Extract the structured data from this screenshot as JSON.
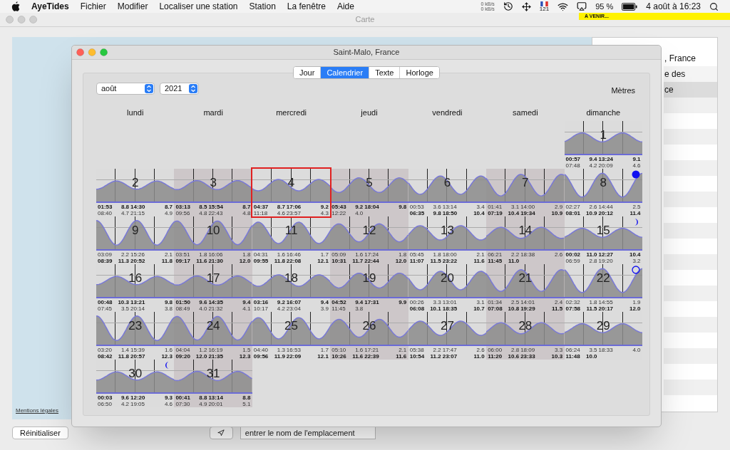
{
  "menu_bar": {
    "app": "AyeTides",
    "items": [
      "Fichier",
      "Modifier",
      "Localiser une station",
      "Station",
      "La fenêtre",
      "Aide"
    ],
    "status": {
      "net_up": "0 kB/s",
      "net_down": "0 kB/s",
      "flag_badge": "121",
      "battery": "95 %",
      "clock": "4 août à 16:23"
    }
  },
  "back_window": {
    "title": "Carte",
    "badge": "A VENIR...",
    "map": {
      "legal_link": "Mentions légales"
    },
    "stations_list": [
      {
        "label": ", France",
        "selected": false
      },
      {
        "label": "e des",
        "selected": false
      },
      {
        "label": "ce",
        "selected": true
      }
    ],
    "reset_button": "Réinitialiser",
    "location_field": {
      "placeholder": "entrer le nom de l'emplacement"
    }
  },
  "window": {
    "title": "Saint-Malo, France",
    "tabs": [
      {
        "label": "Jour",
        "selected": false
      },
      {
        "label": "Calendrier",
        "selected": true
      },
      {
        "label": "Texte",
        "selected": false
      },
      {
        "label": "Horloge",
        "selected": false
      }
    ],
    "month": "août",
    "year": "2021",
    "unit": "Mètres",
    "weekdays": [
      "lundi",
      "mardi",
      "mercredi",
      "jeudi",
      "vendredi",
      "samedi",
      "dimanche"
    ],
    "weeks": [
      [
        {
          "kind": "empty"
        },
        {
          "kind": "empty"
        },
        {
          "kind": "empty"
        },
        {
          "kind": "empty"
        },
        {
          "kind": "empty"
        },
        {
          "kind": "empty"
        },
        {
          "kind": "day",
          "number": "1",
          "selected": false,
          "lines": [
            {
              "high": true,
              "values": [
                "00:57",
                "9.4",
                "13:24",
                "9.1"
              ]
            },
            {
              "high": false,
              "values": [
                "07:48",
                "4.2",
                "20:09",
                "4.6"
              ]
            }
          ]
        }
      ],
      [
        {
          "kind": "day",
          "number": "2",
          "selected": false,
          "lines": [
            {
              "high": true,
              "values": [
                "01:53",
                "8.8",
                "14:30",
                "8.7"
              ]
            },
            {
              "high": false,
              "values": [
                "08:40",
                "4.7",
                "21:15",
                "4.9"
              ]
            }
          ]
        },
        {
          "kind": "day",
          "number": "3",
          "selected": false,
          "lines": [
            {
              "high": true,
              "values": [
                "03:13",
                "8.5",
                "15:54",
                "8.7"
              ]
            },
            {
              "high": false,
              "values": [
                "09:56",
                "4.8",
                "22:43",
                "4.8"
              ]
            }
          ]
        },
        {
          "kind": "day",
          "number": "4",
          "selected": true,
          "lines": [
            {
              "high": true,
              "values": [
                "04:37",
                "8.7",
                "17:06",
                "9.2"
              ]
            },
            {
              "high": false,
              "values": [
                "11:18",
                "4.6",
                "23:57",
                "4.3"
              ]
            }
          ]
        },
        {
          "kind": "day",
          "number": "5",
          "selected": false,
          "lines": [
            {
              "high": true,
              "values": [
                "05:43",
                "9.2",
                "18:04",
                "9.8"
              ]
            },
            {
              "high": false,
              "values": [
                "12:22",
                "4.0"
              ]
            }
          ]
        },
        {
          "kind": "day",
          "number": "6",
          "selected": false,
          "lines": [
            {
              "high": false,
              "values": [
                "00:53",
                "3.6",
                "13:14",
                "3.4"
              ]
            },
            {
              "high": true,
              "values": [
                "06:35",
                "9.8",
                "18:50",
                "10.4"
              ]
            }
          ]
        },
        {
          "kind": "day",
          "number": "7",
          "selected": false,
          "lines": [
            {
              "high": false,
              "values": [
                "01:41",
                "3.1",
                "14:00",
                "2.9"
              ]
            },
            {
              "high": true,
              "values": [
                "07:19",
                "10.4",
                "19:34",
                "10.9"
              ]
            }
          ]
        },
        {
          "kind": "day",
          "number": "8",
          "selected": false,
          "moon": {
            "kind": "new"
          },
          "lines": [
            {
              "high": false,
              "values": [
                "02:27",
                "2.6",
                "14:44",
                "2.5"
              ]
            },
            {
              "high": true,
              "values": [
                "08:01",
                "10.9",
                "20:12",
                "11.4"
              ]
            }
          ]
        }
      ],
      [
        {
          "kind": "day",
          "number": "9",
          "selected": false,
          "lines": [
            {
              "high": false,
              "values": [
                "03:09",
                "2.2",
                "15:26",
                "2.1"
              ]
            },
            {
              "high": true,
              "values": [
                "08:39",
                "11.3",
                "20:52",
                "11.8"
              ]
            }
          ]
        },
        {
          "kind": "day",
          "number": "10",
          "selected": false,
          "lines": [
            {
              "high": false,
              "values": [
                "03:51",
                "1.8",
                "16:06",
                "1.8"
              ]
            },
            {
              "high": true,
              "values": [
                "09:17",
                "11.6",
                "21:30",
                "12.0"
              ]
            }
          ]
        },
        {
          "kind": "day",
          "number": "11",
          "selected": false,
          "lines": [
            {
              "high": false,
              "values": [
                "04:31",
                "1.6",
                "16:46",
                "1.7"
              ]
            },
            {
              "high": true,
              "values": [
                "09:55",
                "11.8",
                "22:08",
                "12.1"
              ]
            }
          ]
        },
        {
          "kind": "day",
          "number": "12",
          "selected": false,
          "lines": [
            {
              "high": false,
              "values": [
                "05:09",
                "1.6",
                "17:24",
                "1.8"
              ]
            },
            {
              "high": true,
              "values": [
                "10:31",
                "11.7",
                "22:44",
                "12.0"
              ]
            }
          ]
        },
        {
          "kind": "day",
          "number": "13",
          "selected": false,
          "lines": [
            {
              "high": false,
              "values": [
                "05:45",
                "1.8",
                "18:00",
                "2.1"
              ]
            },
            {
              "high": true,
              "values": [
                "11:07",
                "11.5",
                "23:22",
                "11.6"
              ]
            }
          ]
        },
        {
          "kind": "day",
          "number": "14",
          "selected": false,
          "lines": [
            {
              "high": false,
              "values": [
                "06:21",
                "2.2",
                "18:38",
                "2.6"
              ]
            },
            {
              "high": true,
              "values": [
                "11:45",
                "11.0"
              ]
            }
          ]
        },
        {
          "kind": "day",
          "number": "15",
          "selected": false,
          "moon": {
            "kind": "first_quarter"
          },
          "lines": [
            {
              "high": true,
              "values": [
                "00:02",
                "11.0",
                "12:27",
                "10.4"
              ]
            },
            {
              "high": false,
              "values": [
                "06:59",
                "2.8",
                "19:20",
                "3.2"
              ]
            }
          ]
        }
      ],
      [
        {
          "kind": "day",
          "number": "16",
          "selected": false,
          "lines": [
            {
              "high": true,
              "values": [
                "00:48",
                "10.3",
                "13:21",
                "9.8"
              ]
            },
            {
              "high": false,
              "values": [
                "07:45",
                "3.5",
                "20:14",
                "3.8"
              ]
            }
          ]
        },
        {
          "kind": "day",
          "number": "17",
          "selected": false,
          "lines": [
            {
              "high": true,
              "values": [
                "01:50",
                "9.6",
                "14:35",
                "9.4"
              ]
            },
            {
              "high": false,
              "values": [
                "08:49",
                "4.0",
                "21:32",
                "4.1"
              ]
            }
          ]
        },
        {
          "kind": "day",
          "number": "18",
          "selected": false,
          "lines": [
            {
              "high": true,
              "values": [
                "03:16",
                "9.2",
                "16:07",
                "9.4"
              ]
            },
            {
              "high": false,
              "values": [
                "10:17",
                "4.2",
                "23:04",
                "3.9"
              ]
            }
          ]
        },
        {
          "kind": "day",
          "number": "19",
          "selected": false,
          "lines": [
            {
              "high": true,
              "values": [
                "04:52",
                "9.4",
                "17:31",
                "9.9"
              ]
            },
            {
              "high": false,
              "values": [
                "11:45",
                "3.8"
              ]
            }
          ]
        },
        {
          "kind": "day",
          "number": "20",
          "selected": false,
          "lines": [
            {
              "high": false,
              "values": [
                "00:26",
                "3.3",
                "13:01",
                "3.1"
              ]
            },
            {
              "high": true,
              "values": [
                "06:08",
                "10.1",
                "18:35",
                "10.7"
              ]
            }
          ]
        },
        {
          "kind": "day",
          "number": "21",
          "selected": false,
          "lines": [
            {
              "high": false,
              "values": [
                "01:34",
                "2.5",
                "14:01",
                "2.4"
              ]
            },
            {
              "high": true,
              "values": [
                "07:08",
                "10.8",
                "19:29",
                "11.5"
              ]
            }
          ]
        },
        {
          "kind": "day",
          "number": "22",
          "selected": false,
          "moon": {
            "kind": "full"
          },
          "lines": [
            {
              "high": false,
              "values": [
                "02:32",
                "1.8",
                "14:55",
                "1.9"
              ]
            },
            {
              "high": true,
              "values": [
                "07:58",
                "11.5",
                "20:17",
                "12.0"
              ]
            }
          ]
        }
      ],
      [
        {
          "kind": "day",
          "number": "23",
          "selected": false,
          "lines": [
            {
              "high": false,
              "values": [
                "03:20",
                "1.4",
                "15:39",
                "1.6"
              ]
            },
            {
              "high": true,
              "values": [
                "08:42",
                "11.8",
                "20:57",
                "12.3"
              ]
            }
          ]
        },
        {
          "kind": "day",
          "number": "24",
          "selected": false,
          "lines": [
            {
              "high": false,
              "values": [
                "04:04",
                "1.2",
                "16:19",
                "1.5"
              ]
            },
            {
              "high": true,
              "values": [
                "09:20",
                "12.0",
                "21:35",
                "12.3"
              ]
            }
          ]
        },
        {
          "kind": "day",
          "number": "25",
          "selected": false,
          "lines": [
            {
              "high": false,
              "values": [
                "04:40",
                "1.3",
                "16:53",
                "1.7"
              ]
            },
            {
              "high": true,
              "values": [
                "09:56",
                "11.9",
                "22:09",
                "12.1"
              ]
            }
          ]
        },
        {
          "kind": "day",
          "number": "26",
          "selected": false,
          "lines": [
            {
              "high": false,
              "values": [
                "05:10",
                "1.6",
                "17:21",
                "2.1"
              ]
            },
            {
              "high": true,
              "values": [
                "10:26",
                "11.6",
                "22:39",
                "11.6"
              ]
            }
          ]
        },
        {
          "kind": "day",
          "number": "27",
          "selected": false,
          "lines": [
            {
              "high": false,
              "values": [
                "05:38",
                "2.2",
                "17:47",
                "2.6"
              ]
            },
            {
              "high": true,
              "values": [
                "10:54",
                "11.2",
                "23:07",
                "11.0"
              ]
            }
          ]
        },
        {
          "kind": "day",
          "number": "28",
          "selected": false,
          "lines": [
            {
              "high": false,
              "values": [
                "06:00",
                "2.8",
                "18:09",
                "3.3"
              ]
            },
            {
              "high": true,
              "values": [
                "11:20",
                "10.6",
                "23:33",
                "10.3"
              ]
            }
          ]
        },
        {
          "kind": "day",
          "number": "29",
          "selected": false,
          "lines": [
            {
              "high": false,
              "values": [
                "06:24",
                "3.5",
                "18:33",
                "4.0"
              ]
            },
            {
              "high": true,
              "values": [
                "11:48",
                "10.0"
              ]
            }
          ]
        }
      ],
      [
        {
          "kind": "day",
          "number": "30",
          "selected": false,
          "moon": {
            "kind": "last_quarter"
          },
          "lines": [
            {
              "high": true,
              "values": [
                "00:03",
                "9.6",
                "12:20",
                "9.3"
              ]
            },
            {
              "high": false,
              "values": [
                "06:50",
                "4.2",
                "19:05",
                "4.6"
              ]
            }
          ]
        },
        {
          "kind": "day",
          "number": "31",
          "selected": false,
          "lines": [
            {
              "high": true,
              "values": [
                "00:41",
                "8.8",
                "13:14",
                "8.8"
              ]
            },
            {
              "high": false,
              "values": [
                "07:30",
                "4.9",
                "20:01",
                "5.1"
              ]
            }
          ]
        }
      ]
    ]
  }
}
